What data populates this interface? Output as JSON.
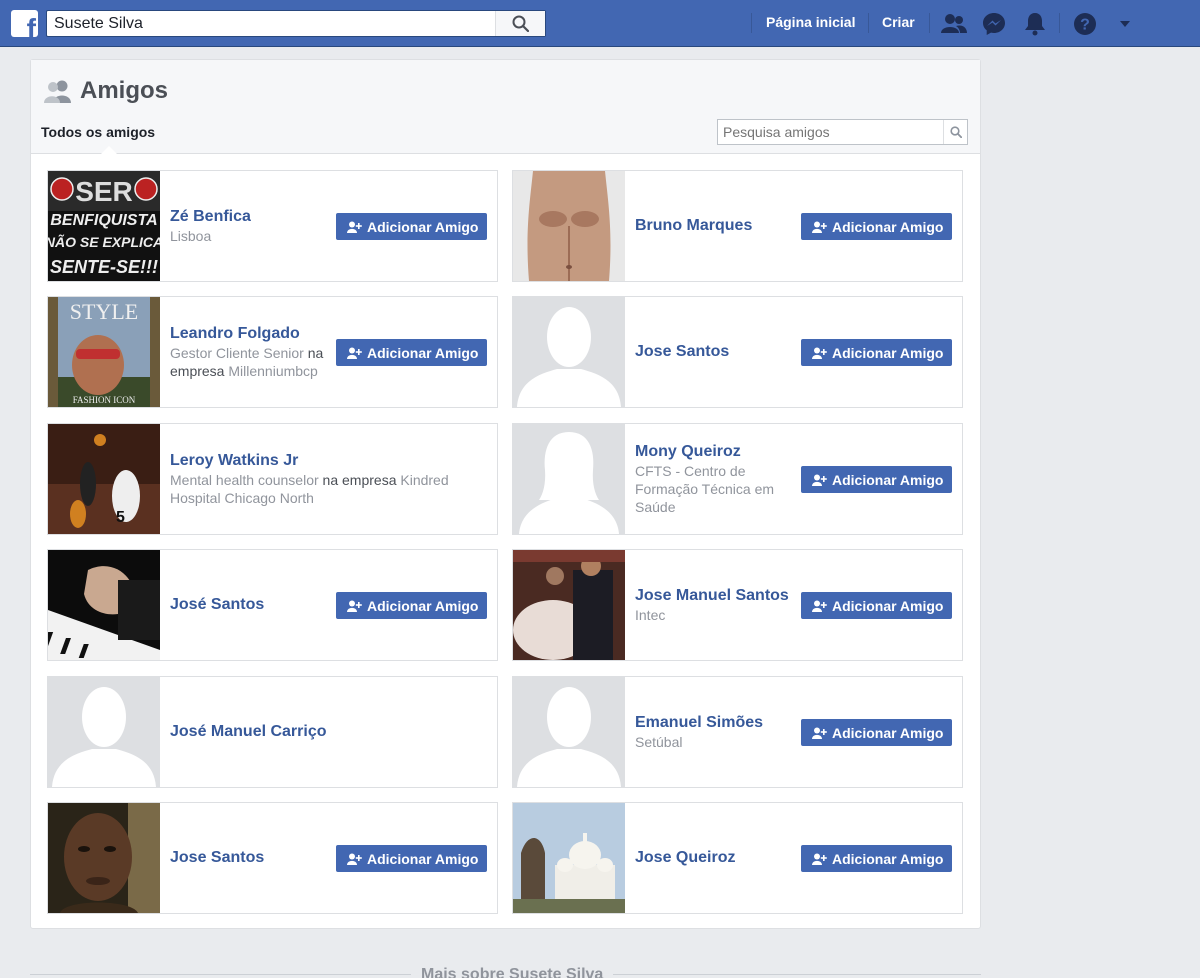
{
  "topbar": {
    "logo": "facebook-f-logo",
    "search_value": "Susete Silva",
    "home_label": "Página inicial",
    "create_label": "Criar",
    "brand_color": "#4267b2"
  },
  "card": {
    "title": "Amigos",
    "tab_all": "Todos os amigos",
    "search_placeholder": "Pesquisa amigos"
  },
  "add_button_label": "Adicionar Amigo",
  "friends": [
    {
      "name": "Zé Benfica",
      "sub": "Lisboa",
      "photo": "benfica-poster",
      "has_button": true
    },
    {
      "name": "Bruno Marques",
      "sub": "",
      "photo": "shirtless-torso",
      "has_button": true
    },
    {
      "name": "Leandro Folgado",
      "sub_a": "Gestor Cliente Senior",
      "sub_b": " na ",
      "sub_c": "empresa",
      "sub_d": " Millenniumbcp",
      "photo": "magazine-cover",
      "has_button": true
    },
    {
      "name": "Jose Santos",
      "sub": "",
      "photo": "default-male",
      "has_button": true
    },
    {
      "name": "Leroy Watkins Jr",
      "sub_a": "Mental health counselor",
      "sub_b": " na ",
      "sub_c": "empresa",
      "sub_d": " Kindred Hospital Chicago North",
      "photo": "basketball",
      "has_button": false
    },
    {
      "name": "Mony Queiroz",
      "sub": "CFTS - Centro de Formação Técnica em Saúde",
      "photo": "default-female",
      "has_button": true
    },
    {
      "name": "José Santos",
      "sub": "",
      "photo": "piano",
      "has_button": true
    },
    {
      "name": "Jose Manuel Santos",
      "sub": "Intec",
      "photo": "wedding",
      "has_button": true
    },
    {
      "name": "José Manuel Carriço",
      "sub": "",
      "photo": "default-male",
      "has_button": false
    },
    {
      "name": "Emanuel Simões",
      "sub": "Setúbal",
      "photo": "default-male",
      "has_button": true
    },
    {
      "name": "Jose Santos",
      "sub": "",
      "photo": "man-portrait",
      "has_button": true
    },
    {
      "name": "Jose Queiroz",
      "sub": "",
      "photo": "sacre-coeur",
      "has_button": true
    }
  ],
  "footer_text": "Mais sobre Susete Silva"
}
